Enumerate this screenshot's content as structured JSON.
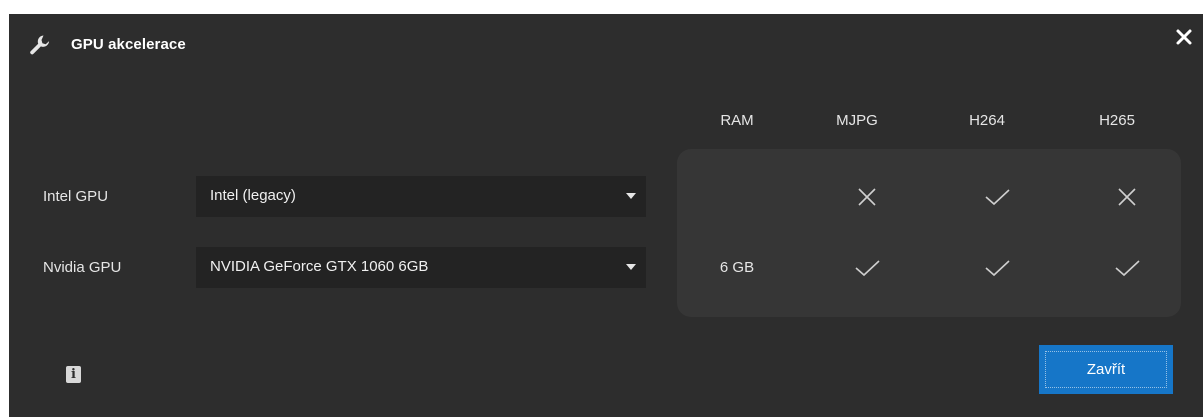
{
  "dialog": {
    "title": "GPU akcelerace",
    "title_icon": "wrench-icon",
    "close_icon": "close-icon",
    "background_color": "#2d2d2d"
  },
  "table": {
    "headers": {
      "ram": "RAM",
      "mjpg": "MJPG",
      "h264": "H264",
      "h265": "H265"
    },
    "rows": [
      {
        "label": "Intel GPU",
        "selected": "Intel (legacy)",
        "ram": "",
        "mjpg": "unsupported",
        "h264": "supported",
        "h265": "unsupported"
      },
      {
        "label": "Nvidia GPU",
        "selected": "NVIDIA GeForce GTX 1060 6GB",
        "ram": "6 GB",
        "mjpg": "supported",
        "h264": "supported",
        "h265": "supported"
      }
    ]
  },
  "footer": {
    "info_icon": "info-icon",
    "info_glyph": "i",
    "close_button_label": "Zavřít",
    "accent_color": "#1676c8"
  }
}
